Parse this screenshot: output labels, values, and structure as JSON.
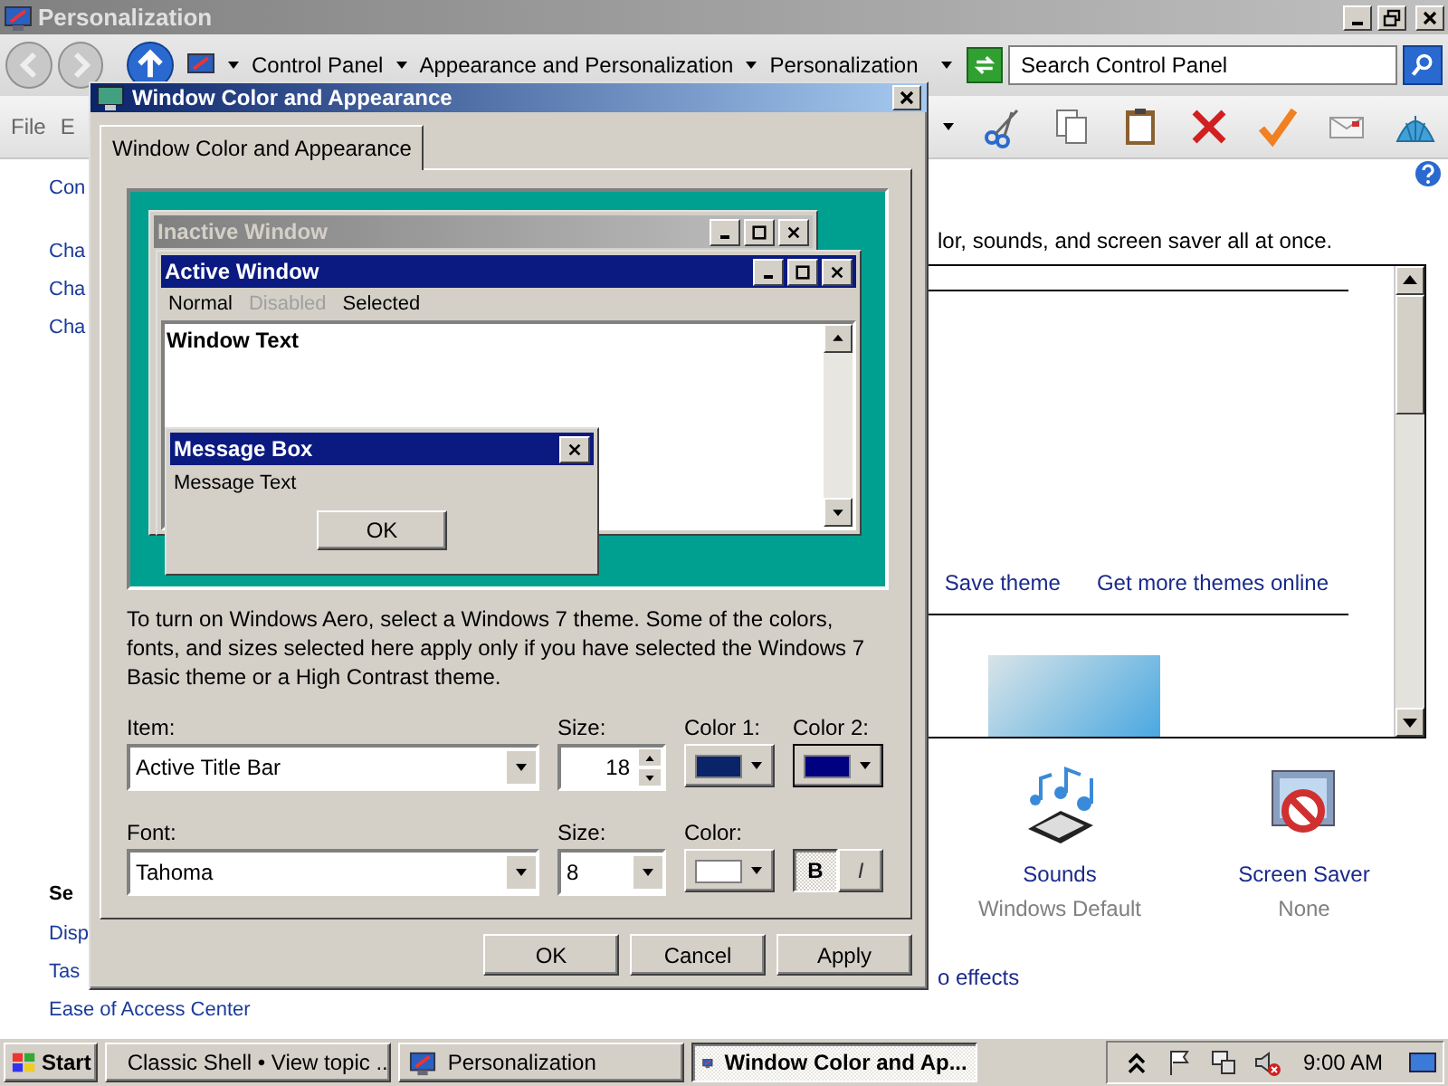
{
  "background_window": {
    "title": "Personalization",
    "crumbs": [
      "Control Panel",
      "Appearance and Personalization",
      "Personalization"
    ],
    "search": {
      "placeholder": "Search Control Panel"
    },
    "menu": [
      "File",
      "E"
    ],
    "sidebar": {
      "top_link": "Con",
      "links": [
        "Cha",
        "Cha",
        "Cha"
      ],
      "see_also_heading": "Se",
      "see_also": [
        "Disp",
        "Tas",
        "Ease of Access Center"
      ]
    },
    "intro": "lor, sounds, and screen saver all at once.",
    "theme_links": [
      "Save theme",
      "Get more themes online"
    ],
    "settings": [
      {
        "kind": "sounds",
        "label": "Sounds",
        "value": "Windows Default"
      },
      {
        "kind": "screensaver",
        "label": "Screen Saver",
        "value": "None"
      }
    ],
    "extra_link": "o effects"
  },
  "dialog": {
    "title": "Window Color and Appearance",
    "tabs": [
      {
        "label": "Window Color and Appearance",
        "selected": true
      }
    ],
    "preview": {
      "inactive_title": "Inactive Window",
      "active_title": "Active Window",
      "menu": [
        {
          "label": "Normal",
          "disabled": false
        },
        {
          "label": "Disabled",
          "disabled": true
        },
        {
          "label": "Selected",
          "disabled": false
        }
      ],
      "window_text": "Window Text",
      "message_title": "Message Box",
      "message_text": "Message Text",
      "message_button": "OK"
    },
    "description": "To turn on Windows Aero, select a Windows 7 theme.  Some of the colors, fonts, and sizes selected here apply only if you have selected the Windows 7 Basic theme or a High Contrast theme.",
    "item": {
      "label": "Item:",
      "value": "Active Title Bar"
    },
    "item_size": {
      "label": "Size:",
      "value": "18"
    },
    "color1": {
      "label": "Color 1:",
      "color": "#0a246a"
    },
    "color2": {
      "label": "Color 2:",
      "color": "#000080"
    },
    "font": {
      "label": "Font:",
      "value": "Tahoma"
    },
    "font_size": {
      "label": "Size:",
      "value": "8"
    },
    "font_color": {
      "label": "Color:",
      "color": "#ffffff"
    },
    "bold": {
      "label": "B",
      "on": true
    },
    "italic": {
      "label": "I",
      "on": false
    },
    "buttons": [
      "OK",
      "Cancel",
      "Apply"
    ]
  },
  "taskbar": {
    "start": "Start",
    "tasks": [
      {
        "label": "Classic Shell • View topic ...",
        "kind": "browser",
        "selected": false
      },
      {
        "label": "Personalization",
        "kind": "panel",
        "selected": false
      },
      {
        "label": "Window Color and Ap...",
        "kind": "panel",
        "selected": true
      }
    ],
    "clock": "9:00 AM"
  }
}
